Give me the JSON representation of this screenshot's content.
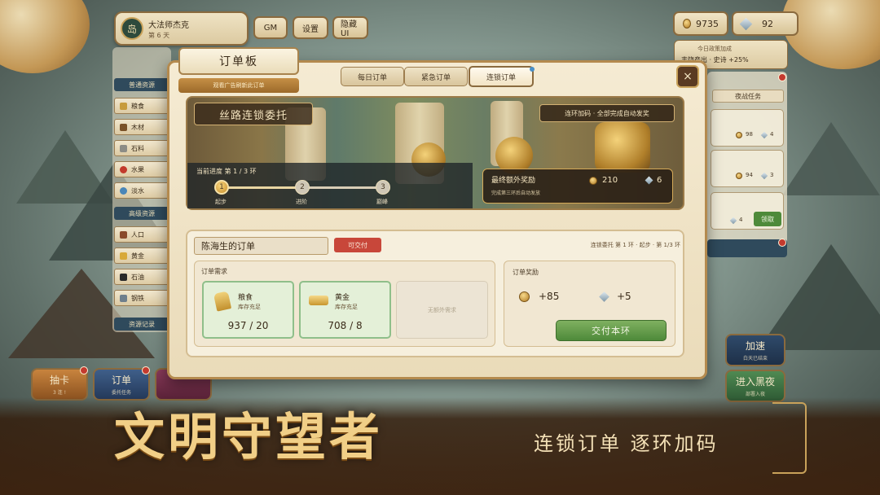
{
  "player": {
    "avatar_char": "岛",
    "name": "大法师杰克",
    "day": "第 6 天"
  },
  "top_buttons": {
    "gm": "GM",
    "settings": "设置",
    "hide_ui": "隐藏UI"
  },
  "resources": {
    "coins": "9735",
    "gems": "92"
  },
  "buff": {
    "label": "今日政策加成",
    "value": "丰饶产出 · 史诗 +25%"
  },
  "sidebar": {
    "header_basic": "普通资源",
    "basic_items": [
      {
        "label": "粮食"
      },
      {
        "label": "木材"
      },
      {
        "label": "石料"
      },
      {
        "label": "水果"
      },
      {
        "label": "淡水"
      }
    ],
    "header_advanced": "高级资源",
    "advanced_items": [
      {
        "label": "人口"
      },
      {
        "label": "黄金"
      },
      {
        "label": "石油"
      },
      {
        "label": "钢铁"
      }
    ],
    "records": "资源记录"
  },
  "right_panel": {
    "header": "夜战任务",
    "cards": [
      {
        "coins": "98",
        "gems": "4"
      },
      {
        "coins": "94",
        "gems": "3"
      },
      {
        "gems": "4",
        "claim": "领取"
      }
    ]
  },
  "bottom_left": {
    "draw": {
      "label": "抽卡",
      "sub": "3 连 !"
    },
    "order": {
      "label": "订单",
      "sub": "委托任务"
    }
  },
  "bottom_right": {
    "speed": {
      "label": "加速",
      "sub": "白天已结束"
    },
    "night": {
      "label": "进入黑夜",
      "sub": "部署入夜"
    }
  },
  "modal": {
    "title": "订单板",
    "subtitle": "观看广告刷新此订单",
    "tabs": [
      {
        "label": "每日订单"
      },
      {
        "label": "紧急订单"
      },
      {
        "label": "连锁订单"
      }
    ],
    "close": "×",
    "banner": {
      "title": "丝路连锁委托",
      "chip": "连环加码 · 全部完成自动发奖",
      "progress_label": "当前进度  第 1 / 3 环",
      "steps": [
        {
          "num": "1",
          "name": "起步"
        },
        {
          "num": "2",
          "name": "进阶"
        },
        {
          "num": "3",
          "name": "巅峰"
        }
      ],
      "final_title": "最终额外奖励",
      "final_sub": "完成第三环后自动发放",
      "final_coins": "210",
      "final_gems": "6"
    },
    "order": {
      "name": "陈海生的订单",
      "status": "可交付",
      "progress": "连锁委托 第 1 环 · 起步 · 第 1/3 环",
      "requirements_title": "订单需求",
      "items": [
        {
          "name": "粮食",
          "stock": "库存充足",
          "count": "937 / 20"
        },
        {
          "name": "黄金",
          "stock": "库存充足",
          "count": "708 / 8"
        }
      ],
      "empty_slot": "无额外需求",
      "reward_title": "订单奖励",
      "reward_coins": "+85",
      "reward_gems": "+5",
      "submit": "交付本环"
    }
  },
  "slogan": {
    "title": "文明守望者",
    "tagline": "连锁订单  逐环加码"
  }
}
